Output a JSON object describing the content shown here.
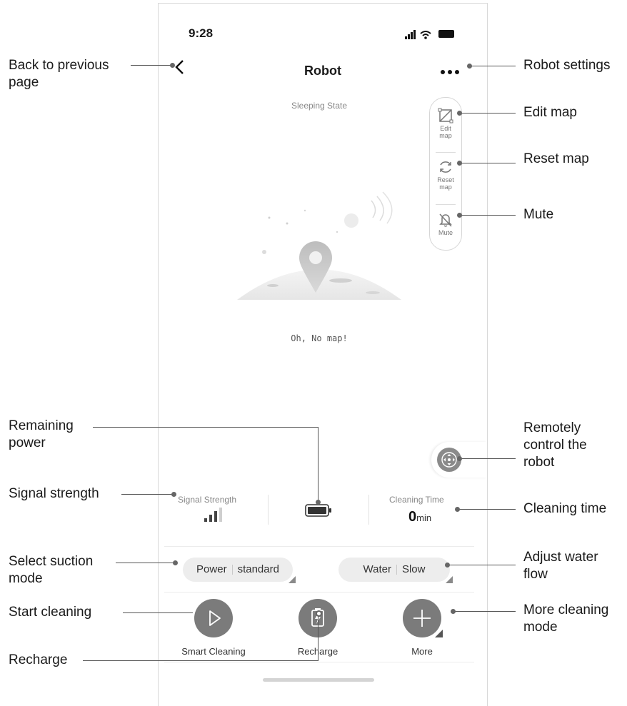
{
  "status_bar": {
    "time": "9:28"
  },
  "header": {
    "title": "Robot",
    "state": "Sleeping State"
  },
  "side_tools": [
    {
      "label_line1": "Edit",
      "label_line2": "map",
      "icon": "edit-map-icon"
    },
    {
      "label_line1": "Reset",
      "label_line2": "map",
      "icon": "reset-map-icon"
    },
    {
      "label_line1": "Mute",
      "label_line2": "",
      "icon": "bell-mute-icon"
    }
  ],
  "map": {
    "empty_text": "Oh, No map!"
  },
  "stats": {
    "signal_label": "Signal Strength",
    "cleaning_label": "Cleaning Time",
    "cleaning_value": "0",
    "cleaning_unit": "min"
  },
  "modes": {
    "power_label": "Power",
    "power_value": "standard",
    "water_label": "Water",
    "water_value": "Slow"
  },
  "actions": {
    "smart_cleaning": "Smart Cleaning",
    "recharge": "Recharge",
    "more": "More"
  },
  "callouts": {
    "back": [
      "Back to previous",
      "page"
    ],
    "settings": "Robot settings",
    "edit_map": "Edit map",
    "reset_map": "Reset map",
    "mute": "Mute",
    "remaining_power": [
      "Remaining",
      "power"
    ],
    "remote_control": [
      "Remotely",
      "control the",
      "robot"
    ],
    "signal": "Signal strength",
    "cleaning_time": "Cleaning time",
    "suction": [
      "Select suction",
      "mode"
    ],
    "water_flow": [
      "Adjust water",
      "flow"
    ],
    "start_cleaning": "Start cleaning",
    "more_modes": [
      "More cleaning",
      "mode"
    ],
    "recharge": "Recharge"
  },
  "colors": {
    "accent_gray": "#7b7b7b",
    "line": "#555555"
  }
}
